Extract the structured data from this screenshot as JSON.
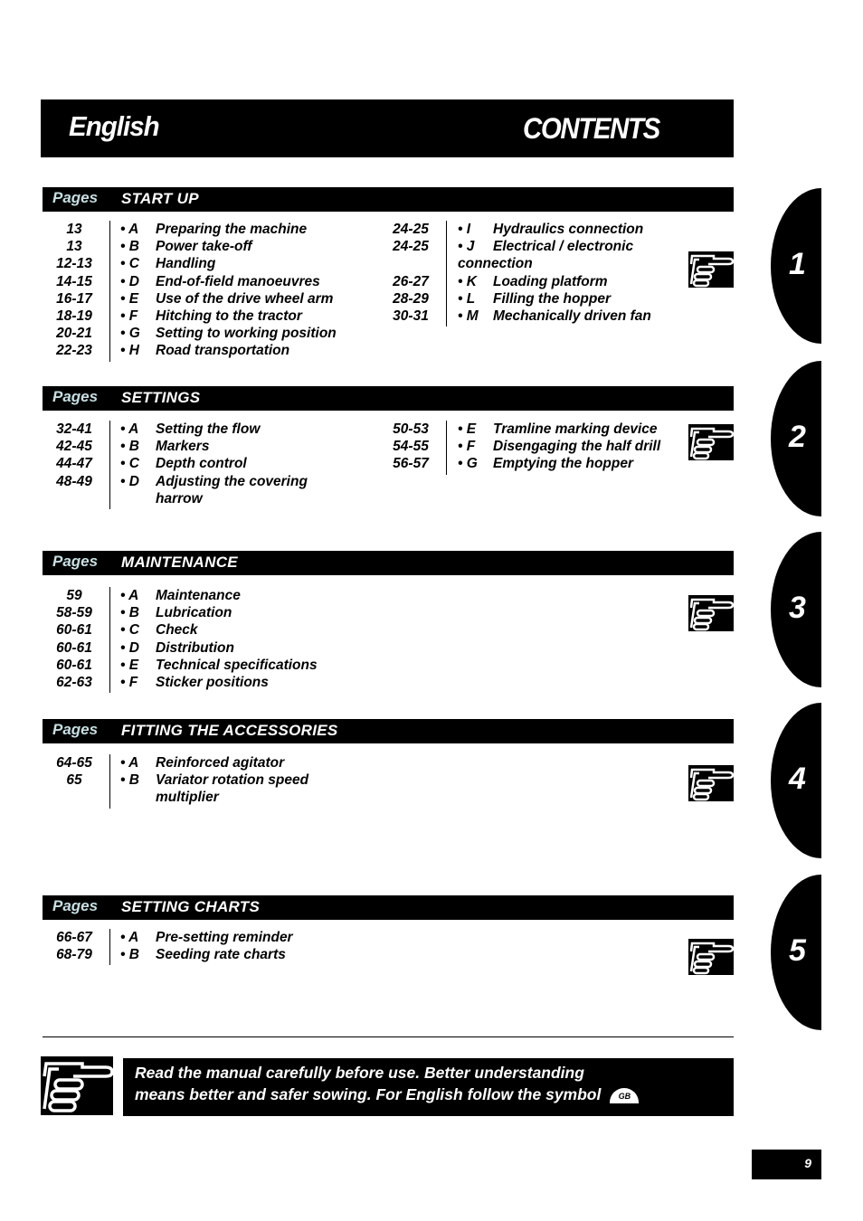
{
  "header": {
    "language": "English",
    "title": "CONTENTS"
  },
  "pages_label": "Pages",
  "sections": [
    {
      "title": "START UP",
      "tab": "1",
      "left": [
        {
          "pages": "13",
          "letter": "• A",
          "label": "Preparing the machine"
        },
        {
          "pages": "13",
          "letter": "• B",
          "label": "Power take-off"
        },
        {
          "pages": "12-13",
          "letter": "• C",
          "label": "Handling"
        },
        {
          "pages": "14-15",
          "letter": "• D",
          "label": "End-of-field manoeuvres"
        },
        {
          "pages": "16-17",
          "letter": "• E",
          "label": "Use of the drive wheel arm"
        },
        {
          "pages": "18-19",
          "letter": "• F",
          "label": "Hitching to the tractor"
        },
        {
          "pages": "20-21",
          "letter": "• G",
          "label": "Setting to working position"
        },
        {
          "pages": "22-23",
          "letter": "• H",
          "label": "Road transportation"
        }
      ],
      "right": [
        {
          "pages": "24-25",
          "letter": "• I",
          "label": "Hydraulics connection"
        },
        {
          "pages": "24-25",
          "letter": "• J",
          "label": "Electrical / electronic",
          "continuation": "connection"
        },
        {
          "pages": "26-27",
          "letter": "• K",
          "label": "Loading platform"
        },
        {
          "pages": "28-29",
          "letter": "• L",
          "label": "Filling the hopper"
        },
        {
          "pages": "30-31",
          "letter": "• M",
          "label": "Mechanically driven fan"
        }
      ]
    },
    {
      "title": "SETTINGS",
      "tab": "2",
      "left": [
        {
          "pages": "32-41",
          "letter": "• A",
          "label": "Setting the flow"
        },
        {
          "pages": "42-45",
          "letter": "• B",
          "label": "Markers"
        },
        {
          "pages": "44-47",
          "letter": "• C",
          "label": "Depth control"
        },
        {
          "pages": "48-49",
          "letter": "• D",
          "label": "Adjusting the covering",
          "continuation": "harrow"
        }
      ],
      "right": [
        {
          "pages": "50-53",
          "letter": "• E",
          "label": "Tramline marking device"
        },
        {
          "pages": "54-55",
          "letter": "• F",
          "label": "Disengaging the half drill"
        },
        {
          "pages": "56-57",
          "letter": "• G",
          "label": "Emptying the hopper"
        }
      ]
    },
    {
      "title": "MAINTENANCE",
      "tab": "3",
      "left": [
        {
          "pages": "59",
          "letter": "• A",
          "label": "Maintenance"
        },
        {
          "pages": "58-59",
          "letter": "• B",
          "label": "Lubrication"
        },
        {
          "pages": "60-61",
          "letter": "• C",
          "label": "Check"
        },
        {
          "pages": "60-61",
          "letter": "• D",
          "label": "Distribution"
        },
        {
          "pages": "60-61",
          "letter": "• E",
          "label": "Technical specifications"
        },
        {
          "pages": "62-63",
          "letter": "• F",
          "label": "Sticker positions"
        }
      ],
      "right": []
    },
    {
      "title": "FITTING THE ACCESSORIES",
      "tab": "4",
      "left": [
        {
          "pages": "64-65",
          "letter": "• A",
          "label": "Reinforced agitator"
        },
        {
          "pages": "65",
          "letter": "• B",
          "label": "Variator rotation speed",
          "continuation": "multiplier"
        }
      ],
      "right": []
    },
    {
      "title": "SETTING CHARTS",
      "tab": "5",
      "left": [
        {
          "pages": "66-67",
          "letter": "• A",
          "label": "Pre-setting reminder"
        },
        {
          "pages": "68-79",
          "letter": "• B",
          "label": "Seeding rate charts"
        }
      ],
      "right": []
    }
  ],
  "notice": {
    "line1": "Read  the manual carefully before use. Better understanding",
    "line2": "means better and safer sowing. For English follow the symbol",
    "badge": "GB"
  },
  "page_number": "9"
}
